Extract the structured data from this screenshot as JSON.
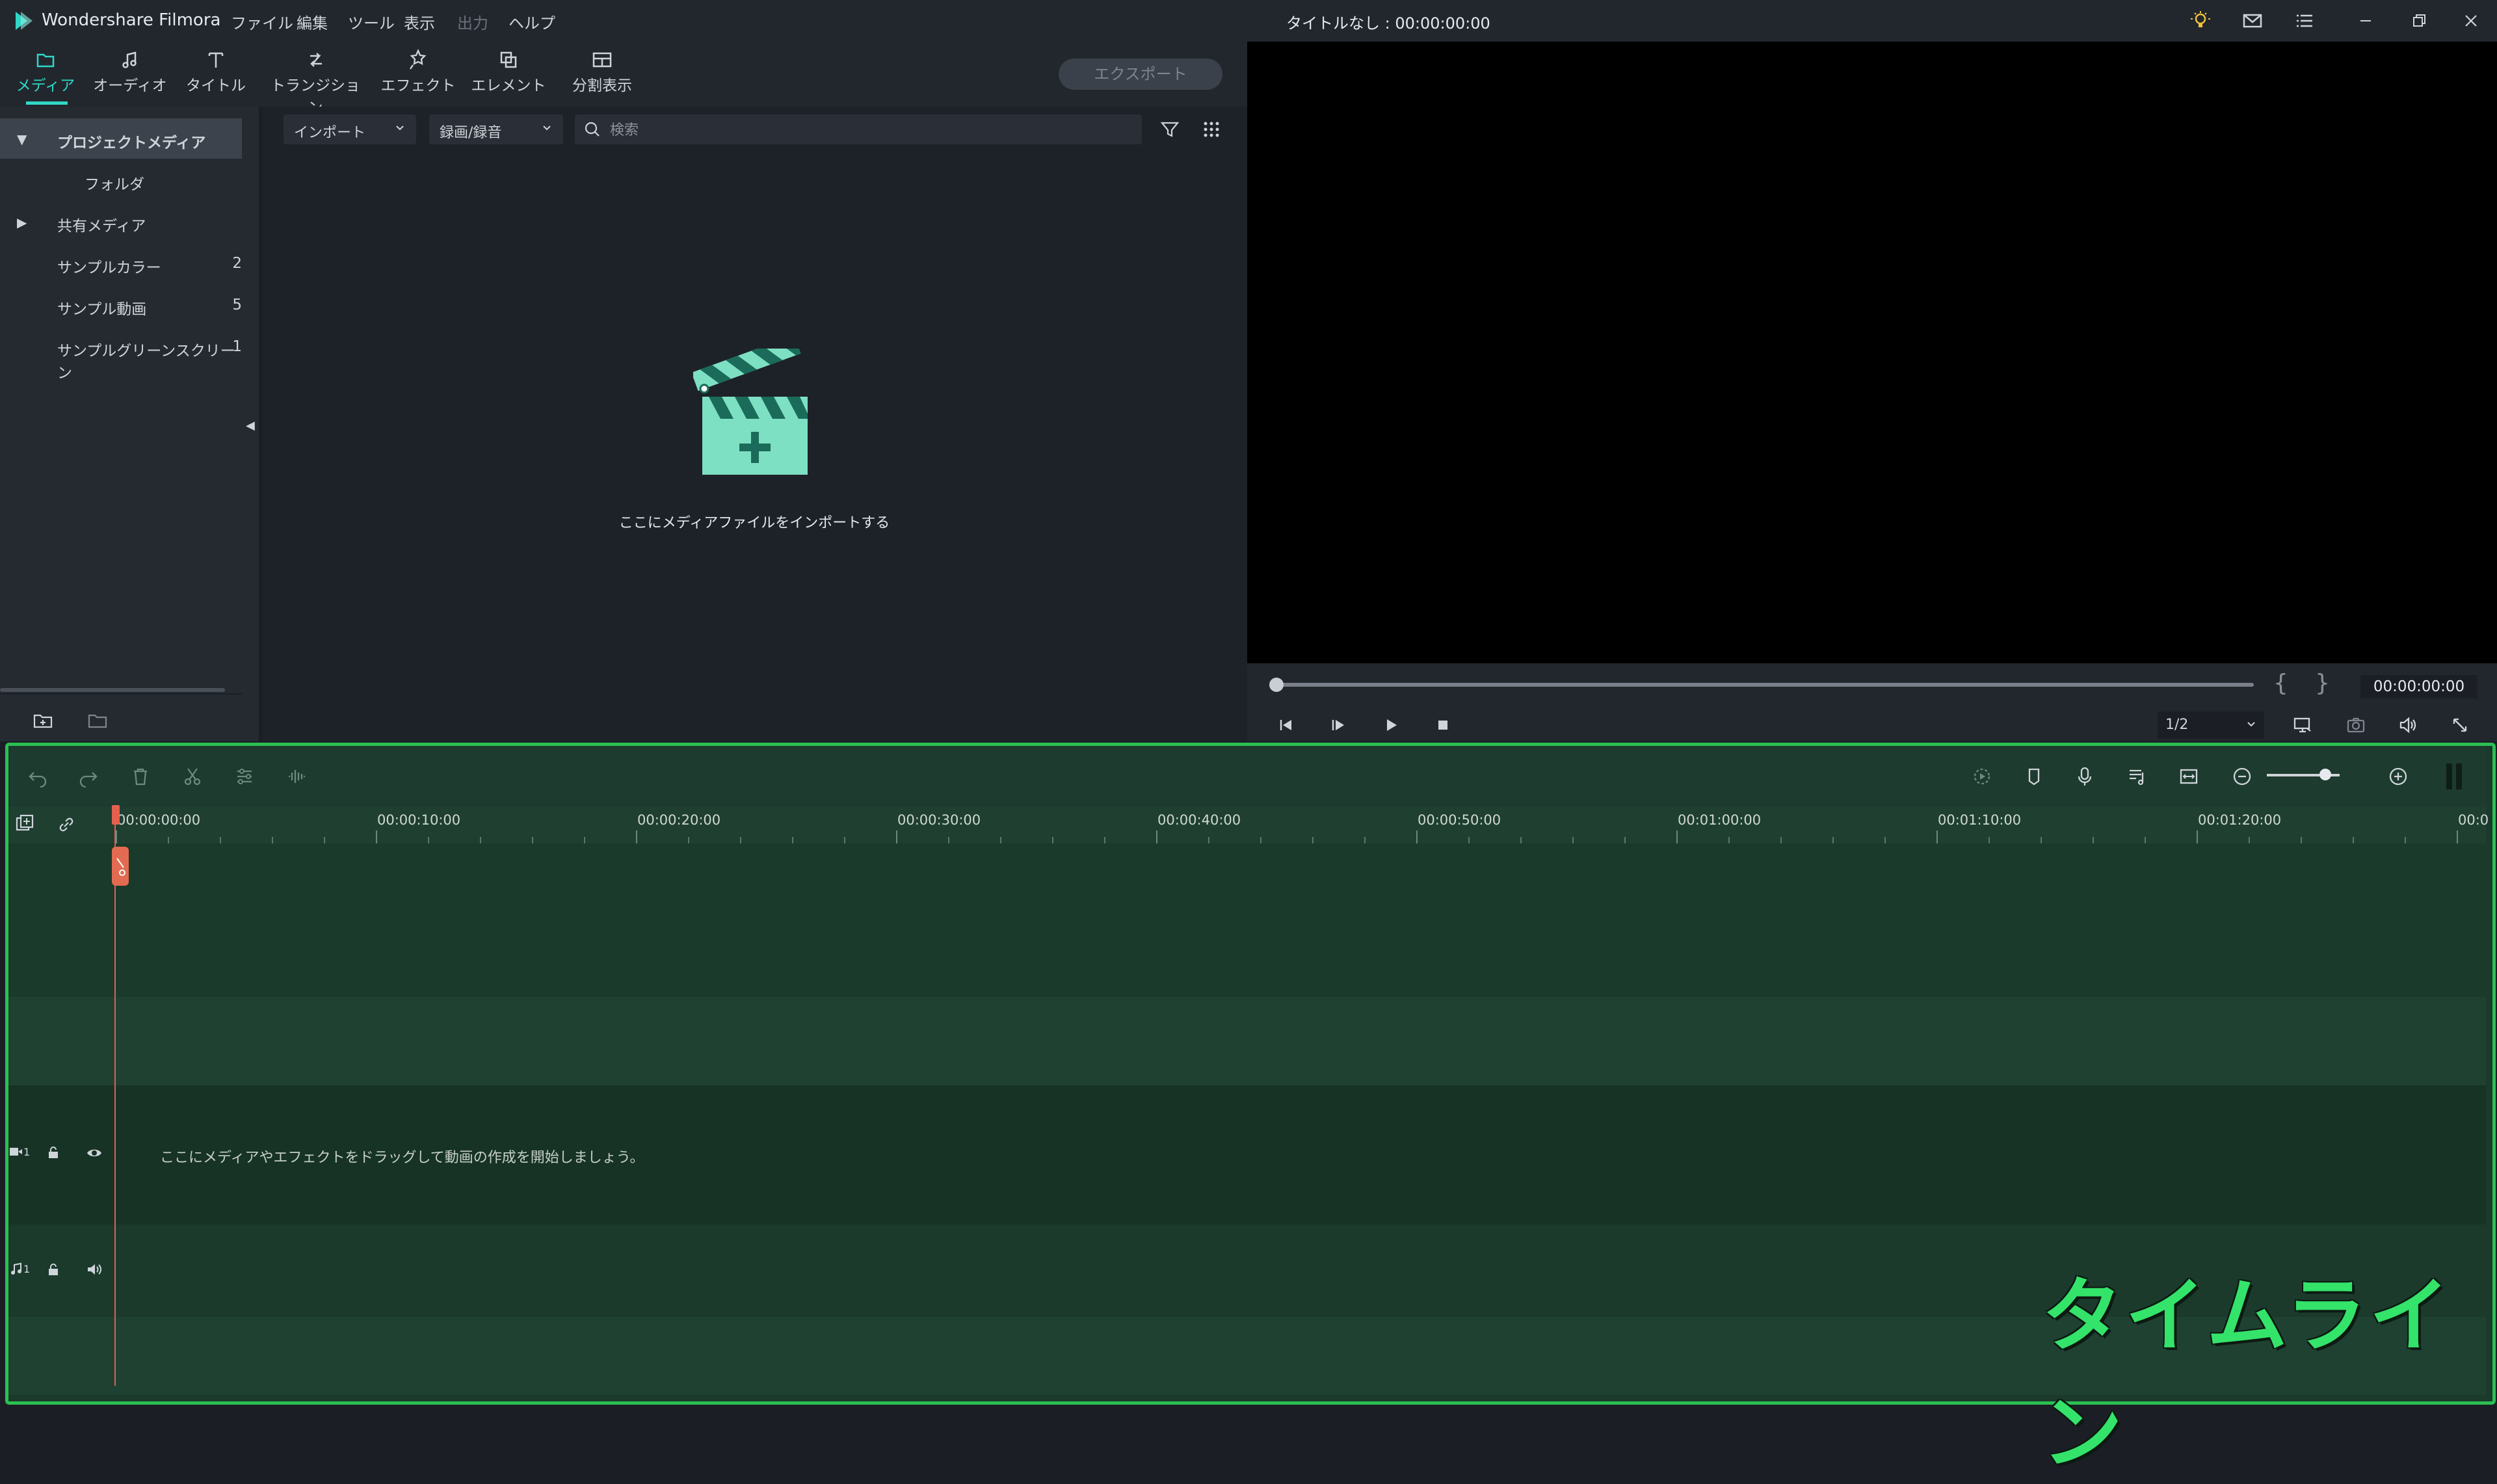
{
  "app": {
    "name": "Wondershare Filmora",
    "document_title": "タイトルなし : 00:00:00:00"
  },
  "menu": [
    "ファイル",
    "編集",
    "ツール",
    "表示",
    "出力",
    "ヘルプ"
  ],
  "tabs": [
    {
      "label": "メディア",
      "icon": "folder-icon",
      "active": true
    },
    {
      "label": "オーディオ",
      "icon": "music-note-icon",
      "active": false
    },
    {
      "label": "タイトル",
      "icon": "text-t-icon",
      "active": false
    },
    {
      "label": "トランジション",
      "icon": "transition-icon",
      "active": false
    },
    {
      "label": "エフェクト",
      "icon": "effects-icon",
      "active": false
    },
    {
      "label": "エレメント",
      "icon": "elements-icon",
      "active": false
    },
    {
      "label": "分割表示",
      "icon": "split-screen-icon",
      "active": false
    }
  ],
  "export_label": "エクスポート",
  "left_panel": {
    "items": [
      {
        "label": "プロジェクトメディア",
        "count": "",
        "expanded": true,
        "selected": true
      },
      {
        "label": "フォルダ",
        "count": "",
        "child": true
      },
      {
        "label": "共有メディア",
        "count": "",
        "collapsed": true
      },
      {
        "label": "サンプルカラー",
        "count": "2"
      },
      {
        "label": "サンプル動画",
        "count": "5"
      },
      {
        "label": "サンプルグリーンスクリーン",
        "count": "1"
      }
    ]
  },
  "media": {
    "import_dropdown": "インポート",
    "record_dropdown": "録画/録音",
    "search_placeholder": "検索",
    "empty_hint": "ここにメディアファイルをインポートする"
  },
  "preview": {
    "timecode": "00:00:00:00",
    "ratio": "1/2",
    "brace_open": "{",
    "brace_close": "}"
  },
  "timeline": {
    "ruler_labels": [
      "00:00:00:00",
      "00:00:10:00",
      "00:00:20:00",
      "00:00:30:00",
      "00:00:40:00",
      "00:00:50:00",
      "00:01:00:00",
      "00:01:10:00",
      "00:01:20:00",
      "00:0"
    ],
    "video_track_num": "1",
    "audio_track_num": "1",
    "drop_hint": "ここにメディアやエフェクトをドラッグして動画の作成を開始しましょう。",
    "overlay_label": "タイムライン",
    "zoom_level": 0.8
  },
  "colors": {
    "accent": "#2fd8c6",
    "timeline_border": "#2bc052",
    "playhead": "#e35f4f",
    "label_green": "#34e36a"
  }
}
